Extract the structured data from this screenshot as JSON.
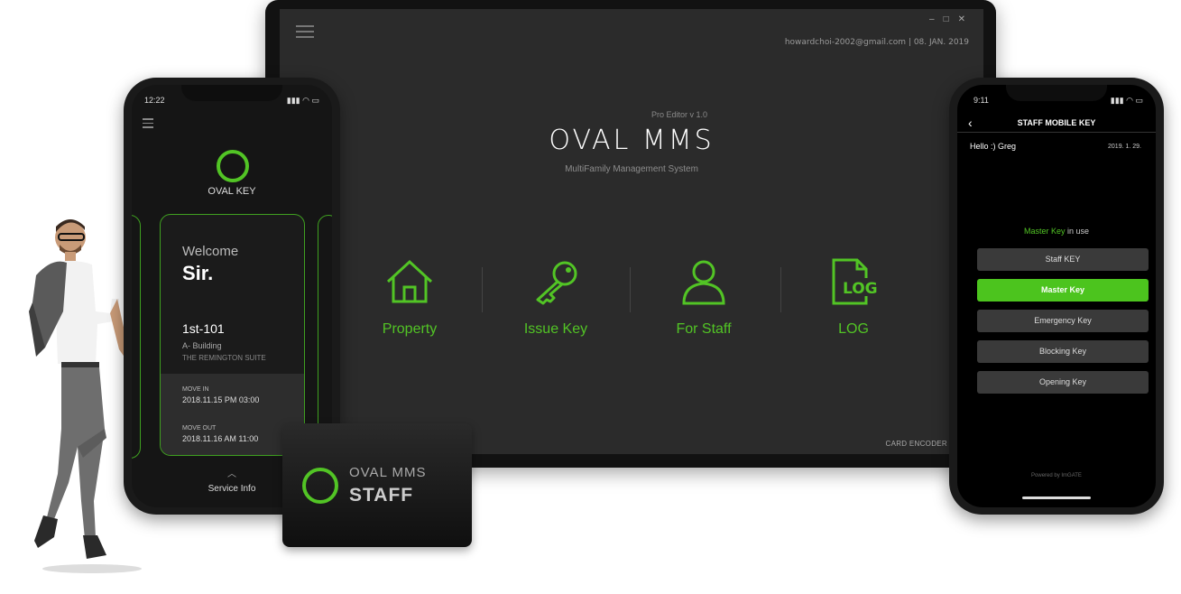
{
  "desktop": {
    "header_text": "howardchoi-2002@gmail.com   |   08. JAN. 2019",
    "editor_version": "Pro Editor v 1.0",
    "title": "OVAL MMS",
    "subtitle": "MultiFamily Management System",
    "menu": [
      {
        "label": "Property",
        "icon": "house-icon"
      },
      {
        "label": "Issue Key",
        "icon": "key-icon"
      },
      {
        "label": "For Staff",
        "icon": "user-icon"
      },
      {
        "label": "LOG",
        "icon": "log-file-icon"
      }
    ],
    "log_icon_text": "LOG",
    "card_encoder": "CARD ENCODER",
    "accent_color": "#52c425"
  },
  "left_phone": {
    "time": "12:22",
    "brand": "OVAL KEY",
    "welcome": "Welcome",
    "name": "Sir.",
    "unit": "1st-101",
    "building": "A- Building",
    "suite": "THE REMINGTON SUITE",
    "move_in_label": "MOVE IN",
    "move_in_value": "2018.11.15   PM 03:00",
    "move_out_label": "MOVE OUT",
    "move_out_value": "2018.11.16   AM 11:00",
    "service_info": "Service Info"
  },
  "staff_card": {
    "line1": "OVAL MMS",
    "line2": "STAFF"
  },
  "right_phone": {
    "time": "9:11",
    "title": "STAFF MOBILE KEY",
    "greeting": "Hello :) Greg",
    "date": "2019. 1. 29.",
    "status_key": "Master Key",
    "status_suffix": " in use",
    "buttons": [
      "Staff KEY",
      "Master Key",
      "Emergency Key",
      "Blocking Key",
      "Opening Key"
    ],
    "active_button": "Master Key",
    "powered_by": "Powered by ImGATE"
  }
}
